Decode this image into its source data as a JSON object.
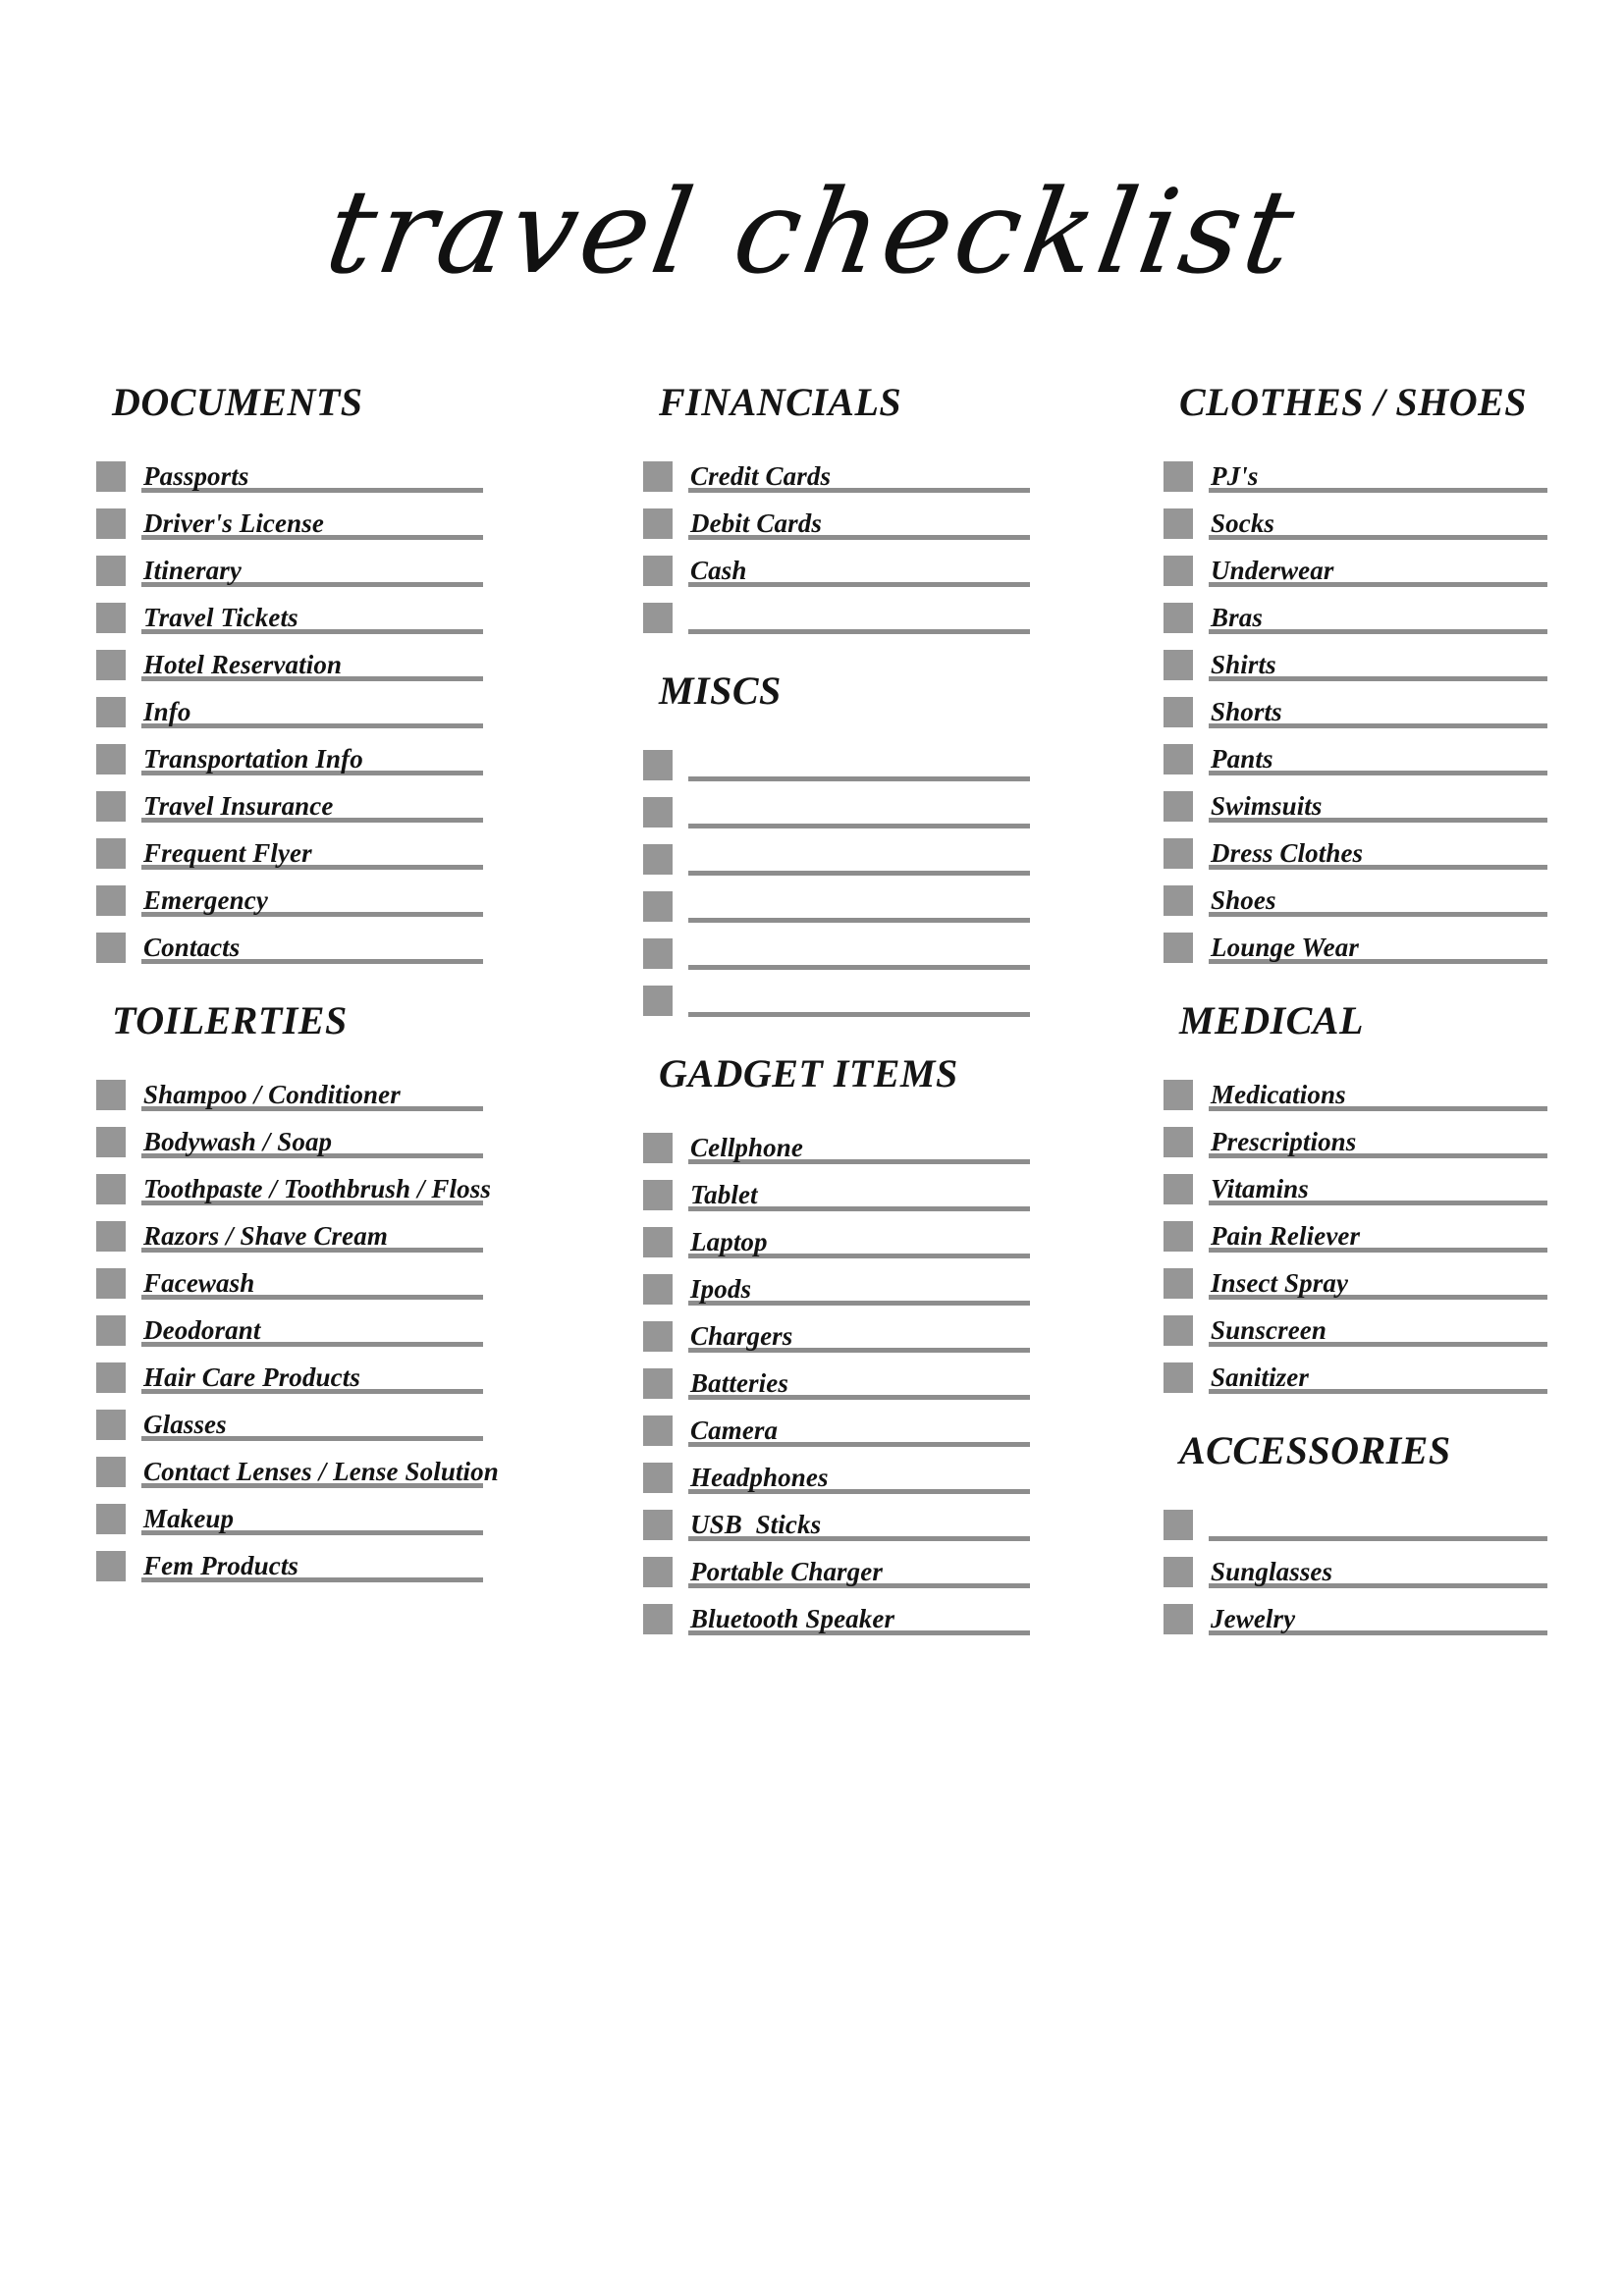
{
  "page": {
    "title": "travel checklist"
  },
  "theme": {
    "checkbox_color": "#969696",
    "line_color": "#8d8d8d",
    "text_color": "#131313",
    "background": "#ffffff"
  },
  "columns": [
    {
      "id": "column-left",
      "sections": [
        {
          "id": "documents",
          "heading": "DOCUMENTS",
          "items": [
            "Passports",
            "Driver's License",
            "Itinerary",
            "Travel Tickets",
            "Hotel Reservation",
            "Info",
            "Transportation Info",
            "Travel Insurance",
            "Frequent Flyer",
            "Emergency",
            "Contacts"
          ]
        },
        {
          "id": "toilerties",
          "heading": "TOILERTIES",
          "items": [
            "Shampoo / Conditioner",
            "Bodywash / Soap",
            "Toothpaste / Toothbrush / Floss",
            "Razors / Shave Cream",
            "Facewash",
            "Deodorant",
            "Hair Care Products",
            "Glasses",
            "Contact Lenses / Lense Solution",
            "Makeup",
            "Fem Products"
          ]
        }
      ]
    },
    {
      "id": "column-middle",
      "sections": [
        {
          "id": "financials",
          "heading": "FINANCIALS",
          "items": [
            "Credit Cards",
            "Debit Cards",
            "Cash",
            ""
          ]
        },
        {
          "id": "miscs",
          "heading": "MISCS",
          "items": [
            "",
            "",
            "",
            "",
            "",
            ""
          ]
        },
        {
          "id": "gadget-items",
          "heading": "GADGET ITEMS",
          "items": [
            "Cellphone",
            "Tablet",
            "Laptop",
            "Ipods",
            "Chargers",
            "Batteries",
            "Camera",
            "Headphones",
            "USB  Sticks",
            "Portable Charger",
            "Bluetooth Speaker"
          ]
        }
      ]
    },
    {
      "id": "column-right",
      "sections": [
        {
          "id": "clothes-shoes",
          "heading": "CLOTHES / SHOES",
          "items": [
            "PJ's",
            "Socks",
            "Underwear",
            "Bras",
            "Shirts",
            "Shorts",
            "Pants",
            "Swimsuits",
            "Dress Clothes",
            "Shoes",
            "Lounge Wear"
          ]
        },
        {
          "id": "medical",
          "heading": "MEDICAL",
          "items": [
            "Medications",
            "Prescriptions",
            "Vitamins",
            "Pain Reliever",
            "Insect Spray",
            "Sunscreen",
            "Sanitizer"
          ]
        },
        {
          "id": "accessories",
          "heading": "ACCESSORIES",
          "items": [
            "",
            "Sunglasses",
            "Jewelry"
          ]
        }
      ]
    }
  ]
}
